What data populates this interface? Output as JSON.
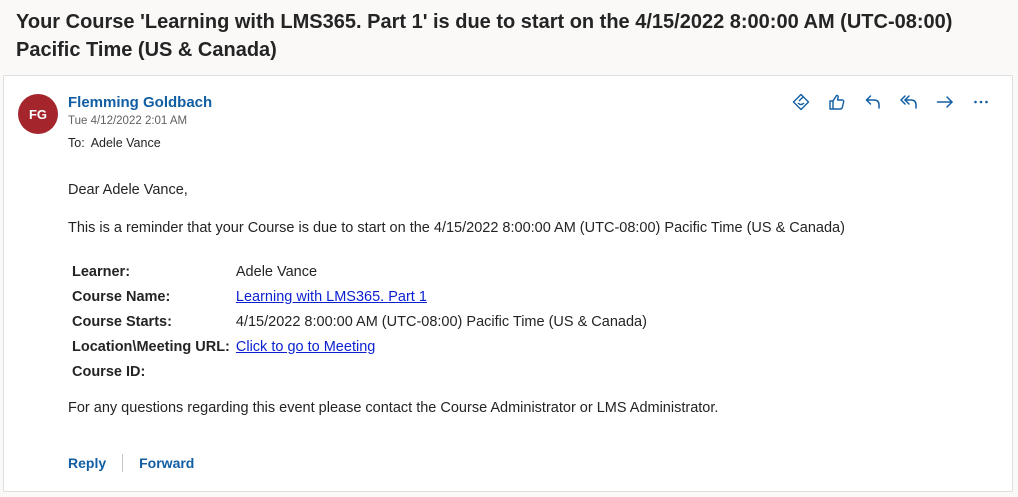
{
  "email": {
    "subject": "Your Course 'Learning with LMS365. Part 1' is due to start on the 4/15/2022 8:00:00 AM (UTC-08:00) Pacific Time (US & Canada)",
    "sender_initials": "FG",
    "sender_name": "Flemming Goldbach",
    "date": "Tue 4/12/2022 2:01 AM",
    "to_label": "To:",
    "to_name": "Adele Vance",
    "greeting": "Dear Adele Vance,",
    "intro": "This is a reminder that your Course is due to start on the 4/15/2022 8:00:00 AM (UTC-08:00) Pacific Time (US & Canada)",
    "details": {
      "learner_label": "Learner:",
      "learner_value": "Adele Vance",
      "course_name_label": "Course Name:",
      "course_name_value": "Learning with LMS365. Part 1",
      "course_starts_label": "Course Starts:",
      "course_starts_value": "4/15/2022 8:00:00 AM (UTC-08:00) Pacific Time (US & Canada)",
      "location_label": "Location\\Meeting URL:",
      "location_value": "Click to go to Meeting",
      "course_id_label": "Course ID:",
      "course_id_value": ""
    },
    "closing": "For any questions regarding this event please contact the Course Administrator or LMS Administrator."
  },
  "toolbar": {
    "icons": [
      "sticker-icon",
      "like-icon",
      "reply-icon",
      "reply-all-icon",
      "forward-icon",
      "more-icon"
    ]
  },
  "footer": {
    "reply_label": "Reply",
    "forward_label": "Forward"
  },
  "colors": {
    "avatar": "#a4262c",
    "accent": "#115ea3",
    "link": "#0b1fd1"
  }
}
